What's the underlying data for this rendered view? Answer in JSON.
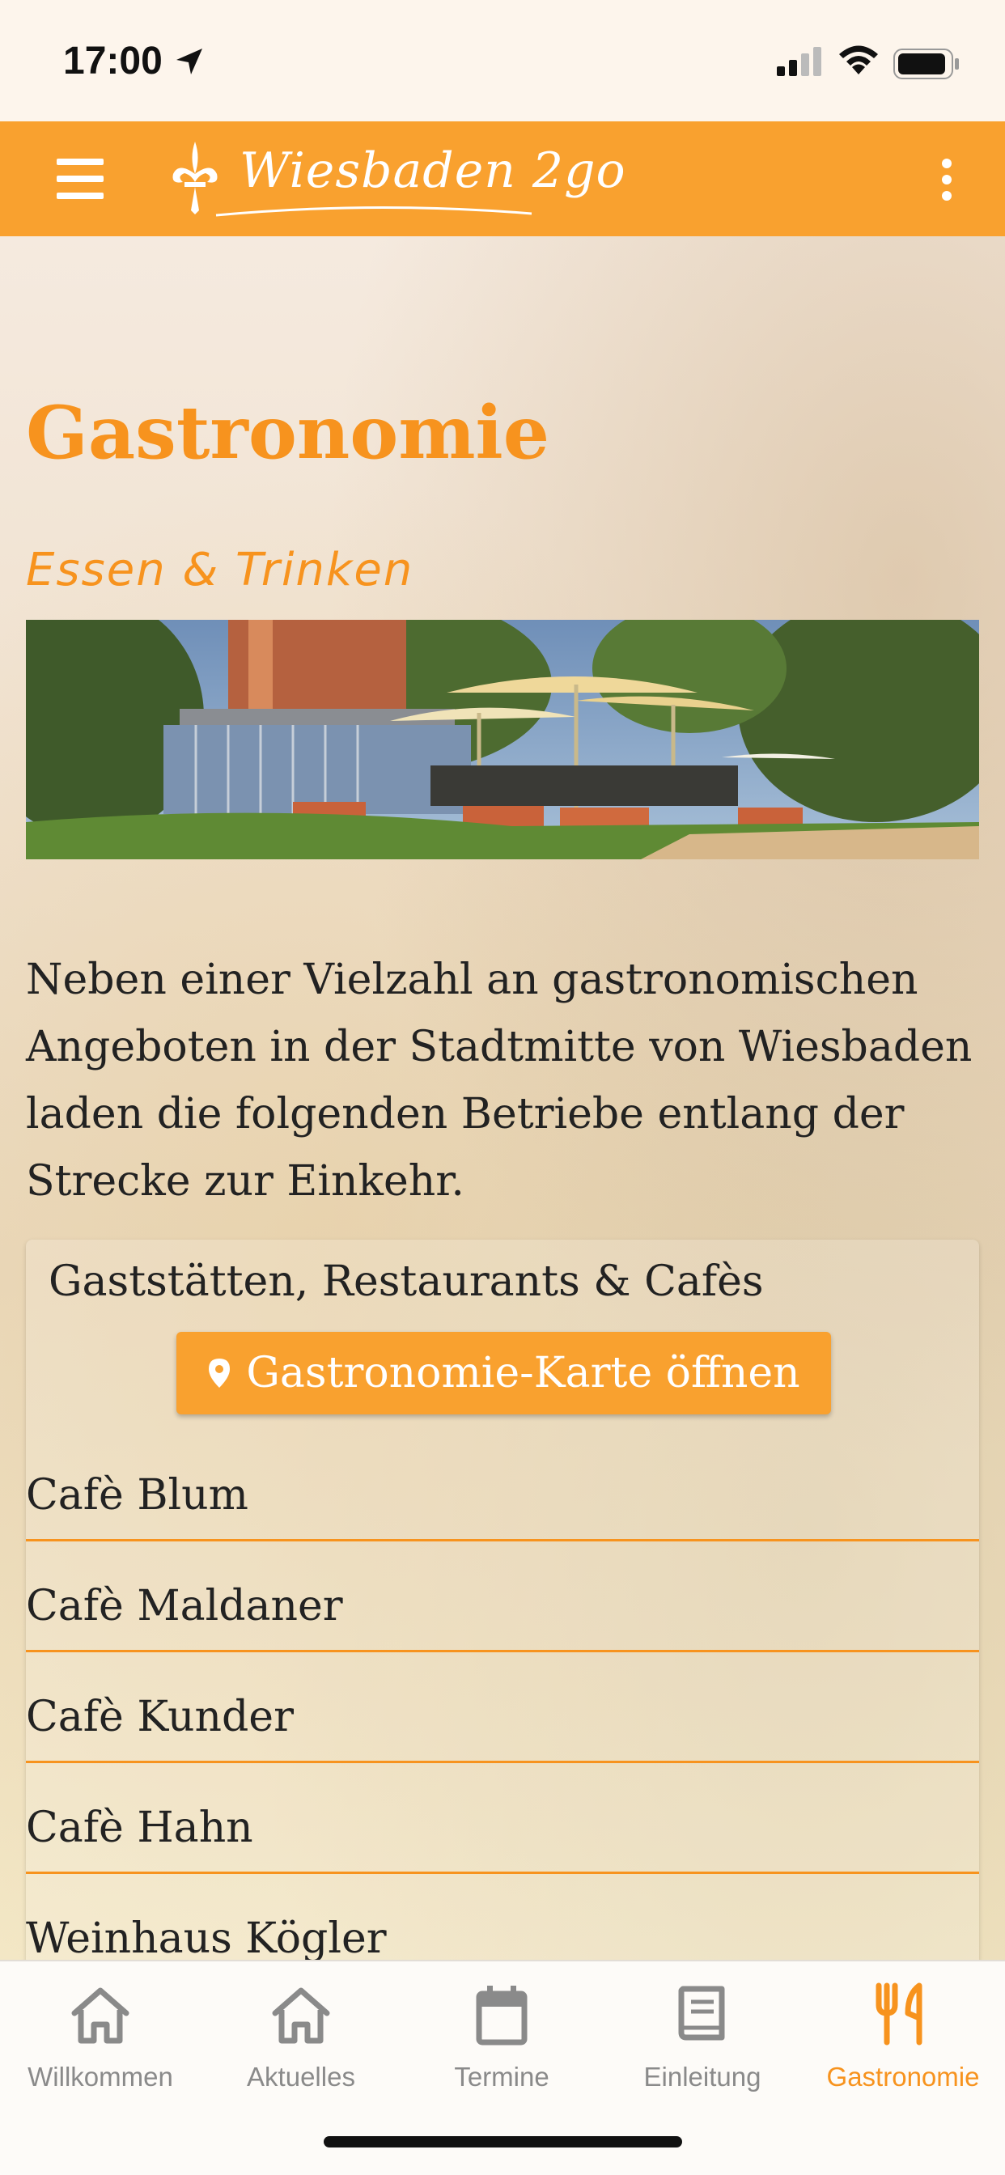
{
  "status_bar": {
    "time": "17:00",
    "location_icon": "location-arrow-icon",
    "signal_icon": "cellular-signal-icon",
    "wifi_icon": "wifi-icon",
    "battery_icon": "battery-icon"
  },
  "app_bar": {
    "menu_icon": "hamburger-menu-icon",
    "logo_text": "Wiesbaden 2go",
    "more_icon": "more-vertical-icon",
    "color": "#f9a12f"
  },
  "page": {
    "title": "Gastronomie",
    "subtitle": "Essen & Trinken",
    "intro": "Neben einer Vielzahl an gastronomischen Angeboten in der Stadtmitte von Wiesbaden laden die folgenden Betriebe entlang der Strecke zur Einkehr."
  },
  "card": {
    "title": "Gaststätten, Restaurants & Cafès",
    "map_button_label": "Gastronomie-Karte öffnen",
    "map_button_icon": "map-pin-icon",
    "items": [
      {
        "label": "Cafè Blum"
      },
      {
        "label": "Cafè Maldaner"
      },
      {
        "label": "Cafè Kunder"
      },
      {
        "label": "Cafè Hahn"
      },
      {
        "label": "Weinhaus Kögler"
      }
    ]
  },
  "tab_bar": {
    "tabs": [
      {
        "label": "Willkommen",
        "icon": "home-icon",
        "active": false
      },
      {
        "label": "Aktuelles",
        "icon": "home-icon",
        "active": false
      },
      {
        "label": "Termine",
        "icon": "calendar-icon",
        "active": false
      },
      {
        "label": "Einleitung",
        "icon": "book-icon",
        "active": false
      },
      {
        "label": "Gastronomie",
        "icon": "fork-knife-icon",
        "active": true
      }
    ],
    "active_color": "#f7931e",
    "inactive_color": "#8a8a8a"
  }
}
